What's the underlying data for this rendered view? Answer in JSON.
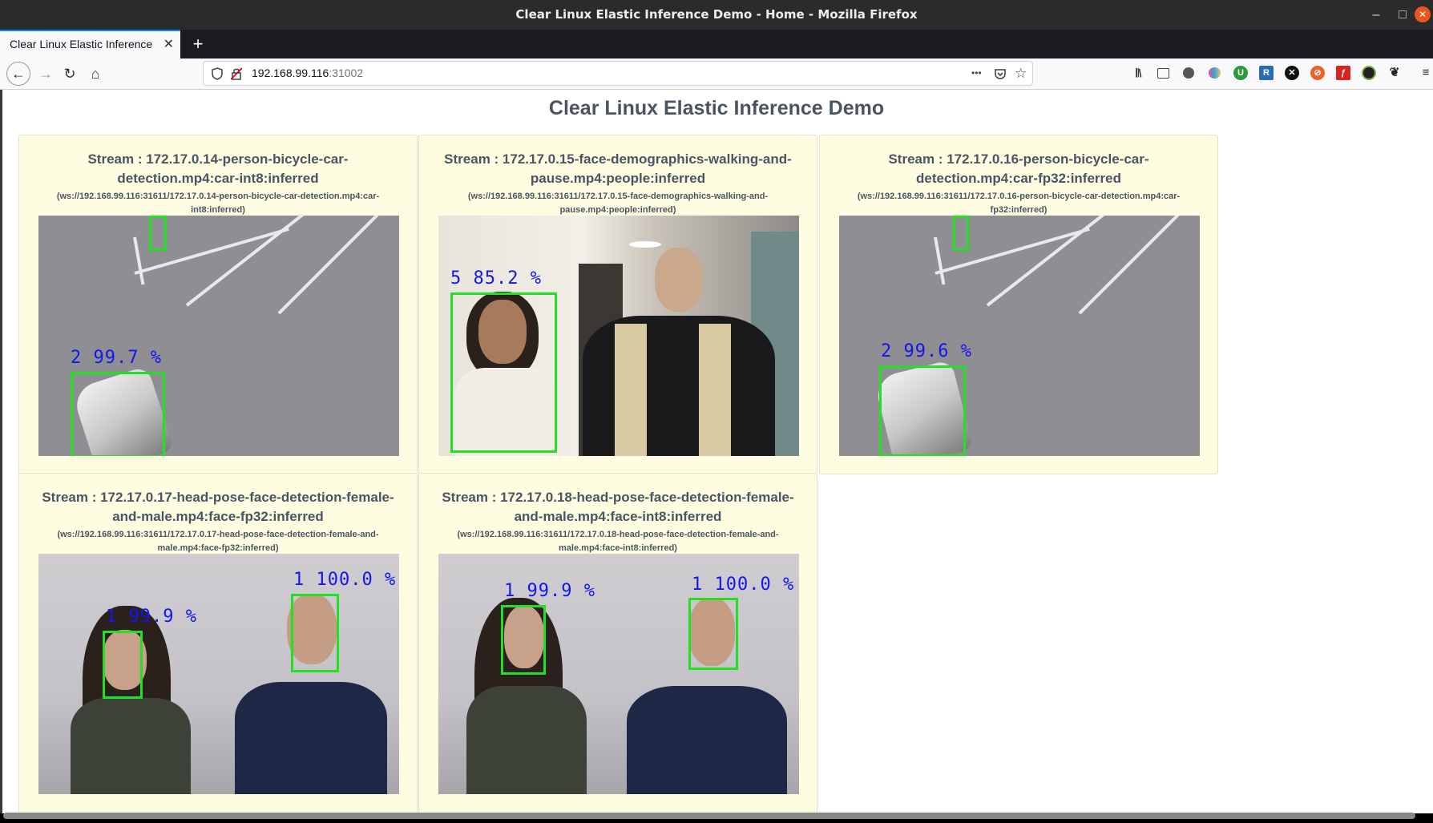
{
  "window": {
    "title": "Clear Linux Elastic Inference Demo - Home - Mozilla Firefox",
    "controls": [
      "–",
      "□",
      "✕"
    ]
  },
  "tab": {
    "label": "Clear Linux Elastic Inference",
    "close": "✕",
    "new_tab": "+"
  },
  "nav": {
    "back": "←",
    "forward": "→",
    "reload": "↻",
    "home": "⌂",
    "url_host": "192.168.99.116",
    "url_port": ":31002",
    "page_actions": "•••",
    "pocket": "◡",
    "bookmark": "☆"
  },
  "toolbar_icons": [
    "library-icon",
    "sidebar-icon",
    "account-icon",
    "extension-heart-icon",
    "extension-green-icon",
    "extension-r-icon",
    "extension-x-icon",
    "extension-orange-icon",
    "extension-red-icon",
    "extension-dark-icon",
    "extension-bird-icon",
    "menu-icon"
  ],
  "page": {
    "title": "Clear Linux Elastic Inference Demo"
  },
  "streams": [
    {
      "title": "Stream : 172.17.0.14-person-bicycle-car-detection.mp4:car-int8:inferred",
      "ws": "(ws://192.168.99.116:31611/172.17.0.14-person-bicycle-car-detection.mp4:car-int8:inferred)",
      "detections": [
        "2 99.7 %"
      ]
    },
    {
      "title": "Stream : 172.17.0.15-face-demographics-walking-and-pause.mp4:people:inferred",
      "ws": "(ws://192.168.99.116:31611/172.17.0.15-face-demographics-walking-and-pause.mp4:people:inferred)",
      "detections": [
        "5 85.2 %"
      ]
    },
    {
      "title": "Stream : 172.17.0.16-person-bicycle-car-detection.mp4:car-fp32:inferred",
      "ws": "(ws://192.168.99.116:31611/172.17.0.16-person-bicycle-car-detection.mp4:car-fp32:inferred)",
      "detections": [
        "2 99.6 %"
      ]
    },
    {
      "title": "Stream : 172.17.0.17-head-pose-face-detection-female-and-male.mp4:face-fp32:inferred",
      "ws": "(ws://192.168.99.116:31611/172.17.0.17-head-pose-face-detection-female-and-male.mp4:face-fp32:inferred)",
      "detections": [
        "1 99.9 %",
        "1 100.0 %"
      ]
    },
    {
      "title": "Stream : 172.17.0.18-head-pose-face-detection-female-and-male.mp4:face-int8:inferred",
      "ws": "(ws://192.168.99.116:31611/172.17.0.18-head-pose-face-detection-female-and-male.mp4:face-int8:inferred)",
      "detections": [
        "1 99.9 %",
        "1 100.0 %"
      ]
    }
  ],
  "colors": {
    "card_bg": "#fffde1",
    "detection_box": "#22e022",
    "detection_label": "#1515ee",
    "title_text": "#4a5563"
  }
}
